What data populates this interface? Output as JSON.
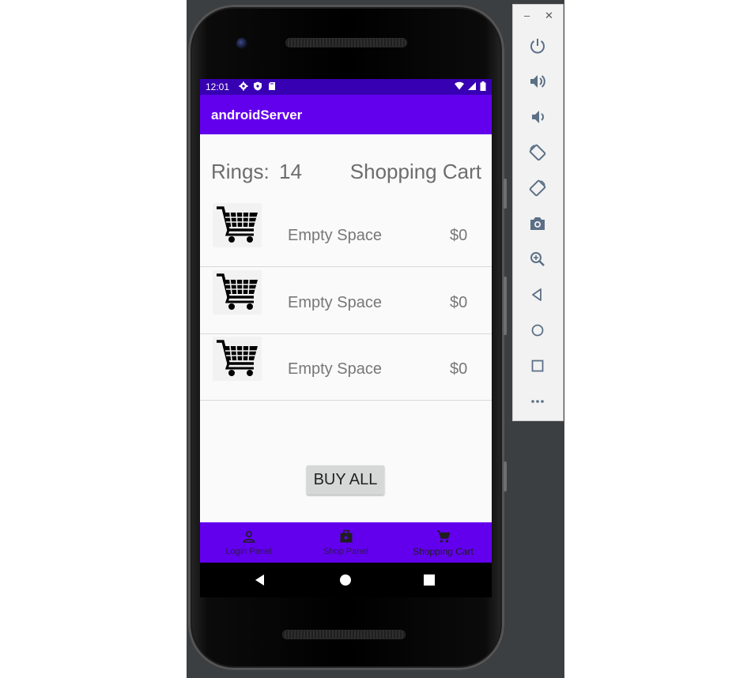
{
  "status_bar": {
    "time": "12:01",
    "left_icons": [
      "gear-icon",
      "shield-icon",
      "sd-card-icon"
    ],
    "right_icons": [
      "wifi-icon",
      "signal-icon",
      "battery-icon"
    ]
  },
  "app_bar": {
    "title": "androidServer"
  },
  "header": {
    "rings_label": "Rings:",
    "rings_value": "14",
    "title": "Shopping Cart"
  },
  "cart": {
    "items": [
      {
        "icon": "shopping-cart-icon",
        "name": "Empty Space",
        "price": "$0"
      },
      {
        "icon": "shopping-cart-icon",
        "name": "Empty Space",
        "price": "$0"
      },
      {
        "icon": "shopping-cart-icon",
        "name": "Empty Space",
        "price": "$0"
      }
    ]
  },
  "buy_all_label": "BUY ALL",
  "bottom_nav": {
    "items": [
      {
        "label": "Login Panel",
        "icon": "person-icon"
      },
      {
        "label": "Shop Panel",
        "icon": "shop-bag-icon"
      },
      {
        "label": "Shopping Cart",
        "icon": "cart-icon",
        "active": true
      }
    ]
  },
  "emulator_toolbar": {
    "window_controls": [
      "minimize-icon",
      "close-icon"
    ],
    "buttons": [
      "power-icon",
      "volume-up-icon",
      "volume-down-icon",
      "rotate-left-icon",
      "rotate-right-icon",
      "camera-icon",
      "zoom-icon",
      "back-icon",
      "home-icon",
      "overview-icon",
      "more-icon"
    ]
  },
  "colors": {
    "primary": "#6200ee",
    "primary_dark": "#3700b3",
    "background": "#fafafa",
    "text_gray": "#6d6d6d",
    "button_gray": "#d6d7d7"
  }
}
